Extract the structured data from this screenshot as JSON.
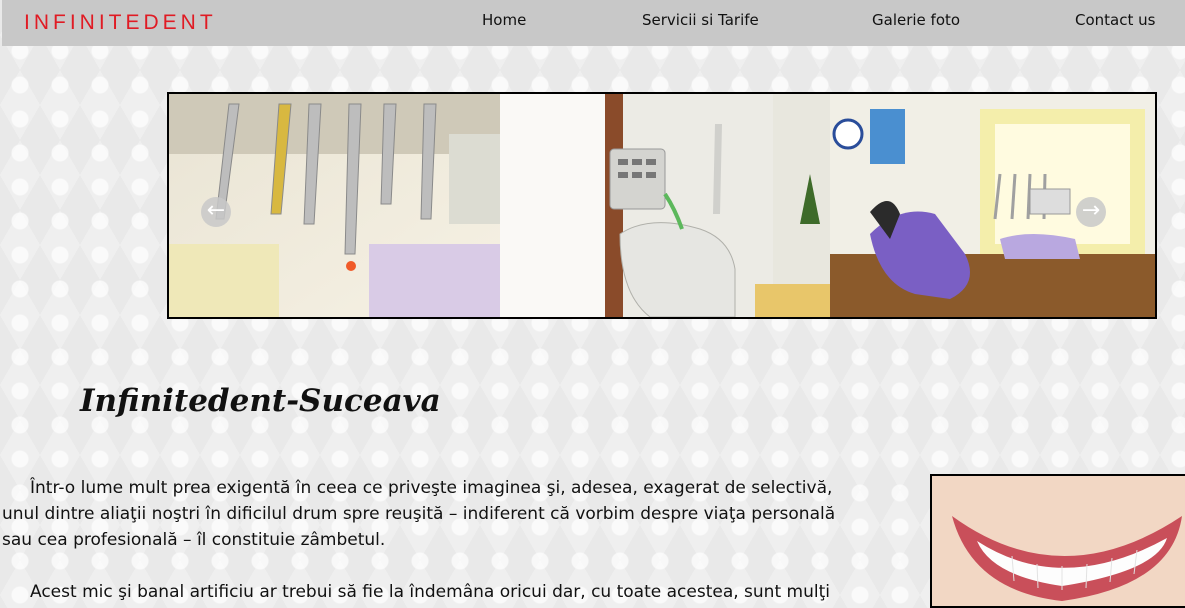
{
  "header": {
    "brand": "INFINITEDENT",
    "nav": [
      "Home",
      "Servicii si Tarife",
      "Galerie foto",
      "Contact us"
    ]
  },
  "slider": {
    "prev_icon": "arrow-left-icon",
    "next_icon": "arrow-right-icon",
    "slides": [
      "dental-instruments-photo",
      "dental-unit-photo",
      "dental-office-photo"
    ]
  },
  "main": {
    "title": "Infinitedent-Suceava",
    "paragraphs": [
      "Într-o lume mult prea exigentă în ceea ce priveşte imaginea şi, adesea, exagerat de selectivă, unul dintre aliaţii noştri în dificilul drum spre reuşită – indiferent că vorbim despre viaţa personală sau cea profesională – îl constituie zâmbetul.",
      "Acest mic şi banal artificiu ar trebui să fie la îndemâna oricui dar, cu toate acestea, sunt mulţi"
    ]
  },
  "colors": {
    "brand": "#e01b24",
    "nav_bg": "#c8c8c8",
    "page_bg": "#efefef"
  }
}
